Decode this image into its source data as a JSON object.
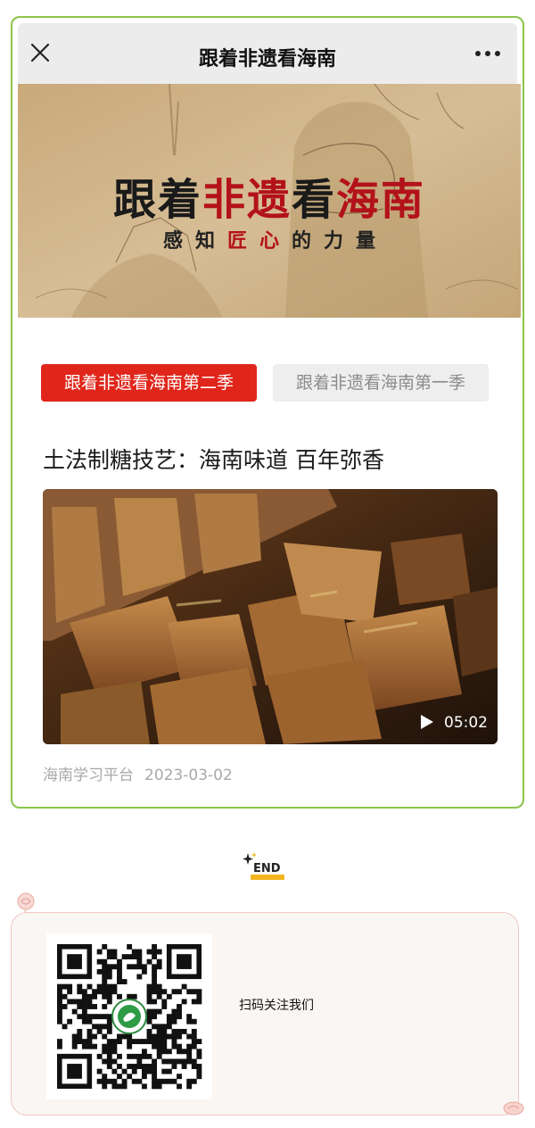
{
  "nav": {
    "title": "跟着非遗看海南",
    "close_icon": "close-icon",
    "more_icon": "more-dots-icon"
  },
  "banner": {
    "title_part1": "跟着",
    "title_part2": "非遗",
    "title_part3": "看",
    "title_part4": "海南",
    "subtitle_part1": "感知",
    "subtitle_part2": "匠心",
    "subtitle_part3": "的力量"
  },
  "tabs": [
    {
      "label": "跟着非遗看海南第二季",
      "active": true
    },
    {
      "label": "跟着非遗看海南第一季",
      "active": false
    }
  ],
  "article": {
    "title": "土法制糖技艺：海南味道 百年弥香",
    "video_duration": "05:02",
    "source": "海南学习平台",
    "date": "2023-03-02"
  },
  "end_mark": "END",
  "follow": {
    "text": "扫码关注我们",
    "qr_icon": "qr-code"
  },
  "colors": {
    "accent_red": "#e0261b",
    "banner_red": "#b3121b",
    "border_green": "#8bc34a",
    "end_bar": "#f3b51f"
  }
}
